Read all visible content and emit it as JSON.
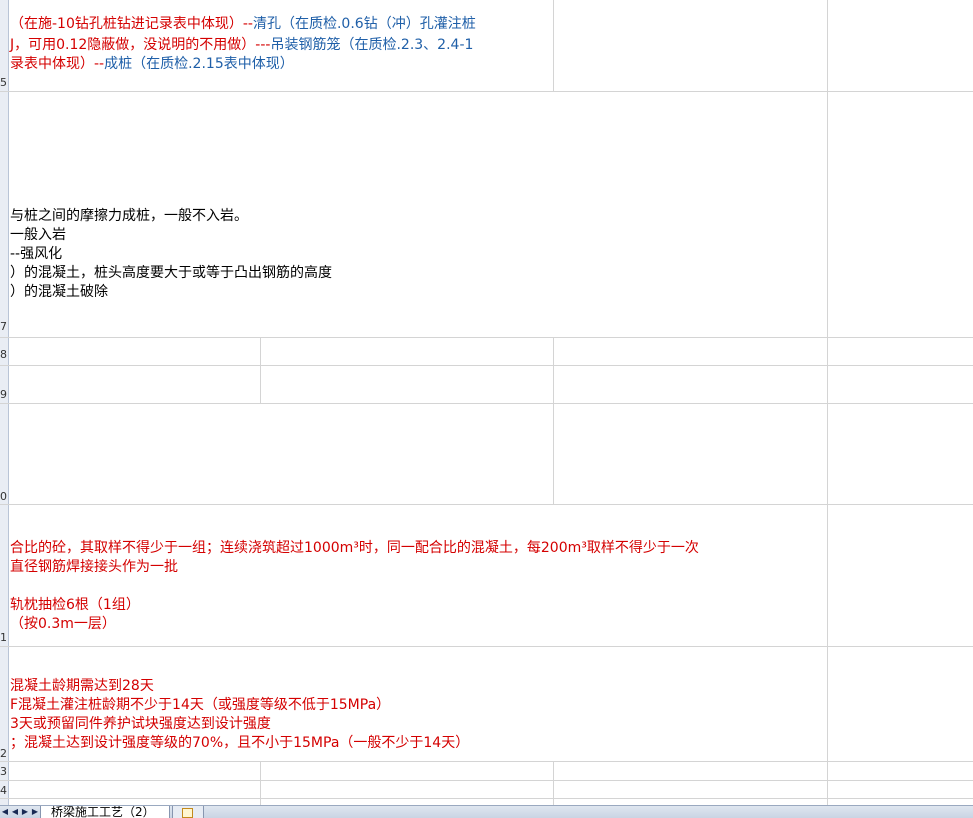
{
  "row_numbers": [
    "5",
    "7",
    "8",
    "9",
    "0",
    "1",
    "2",
    "3",
    "4"
  ],
  "cells": {
    "r5_line1": "（在施-10钻孔桩钻进记录表中体现）--",
    "r5_line1_b": "清孔（在质检.0.6钻（冲）孔灌注桩",
    "r5_line2": "J，可用0.12隐蔽做，没说明的不用做）---",
    "r5_line2_b": "吊装钢筋笼（在质检.2.3、2.4-1",
    "r5_line3": "录表中体现）--",
    "r5_line3_b": "成桩（在质检.2.15表中体现）",
    "r7_line1": "与桩之间的摩擦力成桩，一般不入岩。",
    "r7_line2": "一般入岩",
    "r7_line3": "--强风化",
    "r7_line4": "）的混凝土，桩头高度要大于或等于凸出钢筋的高度",
    "r7_line5": "）的混凝土破除",
    "r1_line1": "合比的砼，其取样不得少于一组；连续浇筑超过1000m³时，同一配合比的混凝土，每200m³取样不得少于一次",
    "r1_line2": "直径钢筋焊接接头作为一批",
    "r1_line3": "轨枕抽检6根（1组）",
    "r1_line4": "（按0.3m一层）",
    "r2_line1": "混凝土龄期需达到28天",
    "r2_line2": "F混凝土灌注桩龄期不少于14天（或强度等级不低于15MPa）",
    "r2_line3": "3天或预留同件养护试块强度达到设计强度",
    "r2_line4": "；混凝土达到设计强度等级的70%，且不小于15MPa（一般不少于14天）"
  },
  "sheet_tabs": {
    "active_tab": "桥梁施工工艺（2）"
  },
  "colors": {
    "red_text": "#d40000",
    "blue_text": "#1f5fa8",
    "gridline": "#d4d4d4"
  }
}
